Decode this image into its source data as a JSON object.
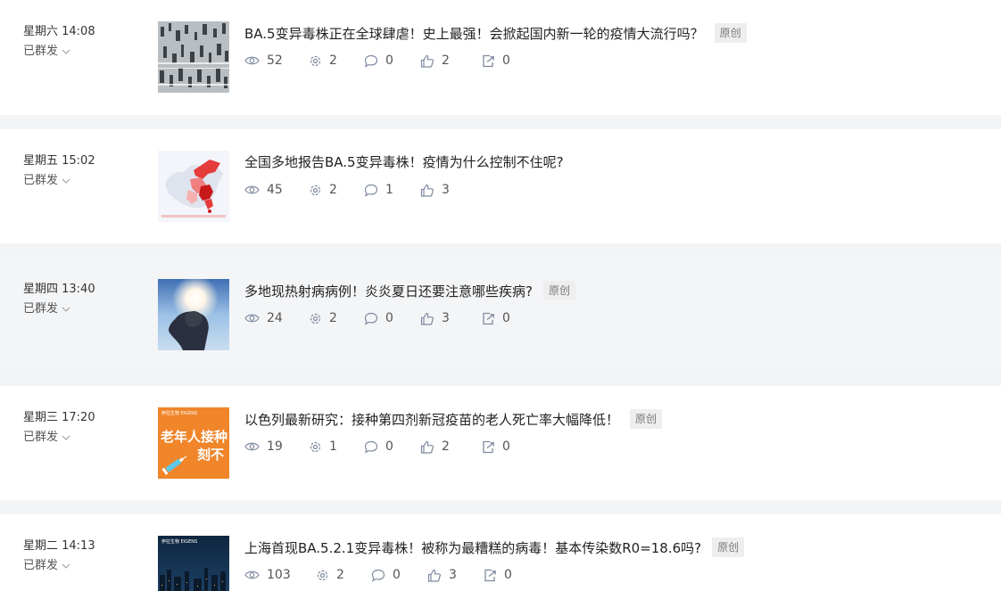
{
  "posts": [
    {
      "time": "星期六 14:08",
      "status": "已群发",
      "title": "BA.5变异毒株正在全球肆虐！史上最强！会掀起国内新一轮的疫情大流行吗？",
      "badge": "原创",
      "views": "52",
      "shares": "2",
      "comments": "0",
      "likes": "2",
      "forwards": "0"
    },
    {
      "time": "星期五 15:02",
      "status": "已群发",
      "title": "全国多地报告BA.5变异毒株！疫情为什么控制不住呢?",
      "badge": "",
      "views": "45",
      "shares": "2",
      "comments": "1",
      "likes": "3",
      "forwards": ""
    },
    {
      "time": "星期四 13:40",
      "status": "已群发",
      "title": "多地现热射病病例！炎炎夏日还要注意哪些疾病?",
      "badge": "原创",
      "views": "24",
      "shares": "2",
      "comments": "0",
      "likes": "3",
      "forwards": "0"
    },
    {
      "time": "星期三 17:20",
      "status": "已群发",
      "title": "以色列最新研究：接种第四剂新冠疫苗的老人死亡率大幅降低！",
      "badge": "原创",
      "views": "19",
      "shares": "1",
      "comments": "0",
      "likes": "2",
      "forwards": "0",
      "thumb_text_1": "老年人接种",
      "thumb_text_2": "刻不",
      "thumb_brand": "伊拉生物 EIGENS"
    },
    {
      "time": "星期二 14:13",
      "status": "已群发",
      "title": "上海首现BA.5.2.1变异毒株！被称为最糟糕的病毒！基本传染数R0=18.6吗?",
      "badge": "原创",
      "views": "103",
      "shares": "2",
      "comments": "0",
      "likes": "3",
      "forwards": "0",
      "thumb_brand": "伊拉生物 EIGENS"
    }
  ],
  "colors": {
    "page_bg": "#f3f4f6",
    "card_bg": "#ffffff",
    "card_hover_bg": "#f4f5f7",
    "icon": "#7f8aa0",
    "badge_bg": "#eeeeee"
  }
}
